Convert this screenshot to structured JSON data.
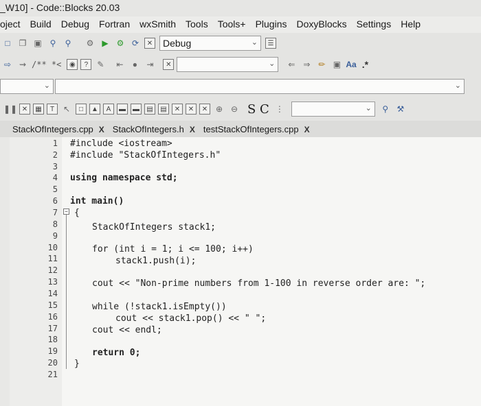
{
  "window": {
    "title": "_W10] - Code::Blocks 20.03"
  },
  "menu": [
    "oject",
    "Build",
    "Debug",
    "Fortran",
    "wxSmith",
    "Tools",
    "Tools+",
    "Plugins",
    "DoxyBlocks",
    "Settings",
    "Help"
  ],
  "toolbar": {
    "build_target": "Debug",
    "comment_marker": "/** *<",
    "regex_marker": ".*",
    "search_letters": "S C"
  },
  "tabs": [
    {
      "label": "StackOfIntegers.cpp",
      "close": "X"
    },
    {
      "label": "StackOfIntegers.h",
      "close": "X"
    },
    {
      "label": "testStackOfIntegers.cpp",
      "close": "X"
    }
  ],
  "editor": {
    "line_numbers": [
      "1",
      "2",
      "3",
      "4",
      "5",
      "6",
      "7",
      "8",
      "9",
      "10",
      "11",
      "12",
      "13",
      "14",
      "15",
      "16",
      "17",
      "18",
      "19",
      "20",
      "21"
    ],
    "lines": [
      "#include <iostream>",
      "#include \"StackOfIntegers.h\"",
      "using namespace std;",
      "int main()",
      "{",
      "StackOfIntegers stack1;",
      "for (int i = 1; i <= 100; i++)",
      "stack1.push(i);",
      "cout << \"Non-prime numbers from 1-100 in reverse order are: \";",
      "while (!stack1.isEmpty())",
      "cout << stack1.pop() << \" \";",
      "cout << endl;",
      "return 0;",
      "}"
    ]
  },
  "colors": {
    "background": "#f6f6f4",
    "gutter": "#ededeb",
    "toolbar": "#e4e4e2"
  }
}
